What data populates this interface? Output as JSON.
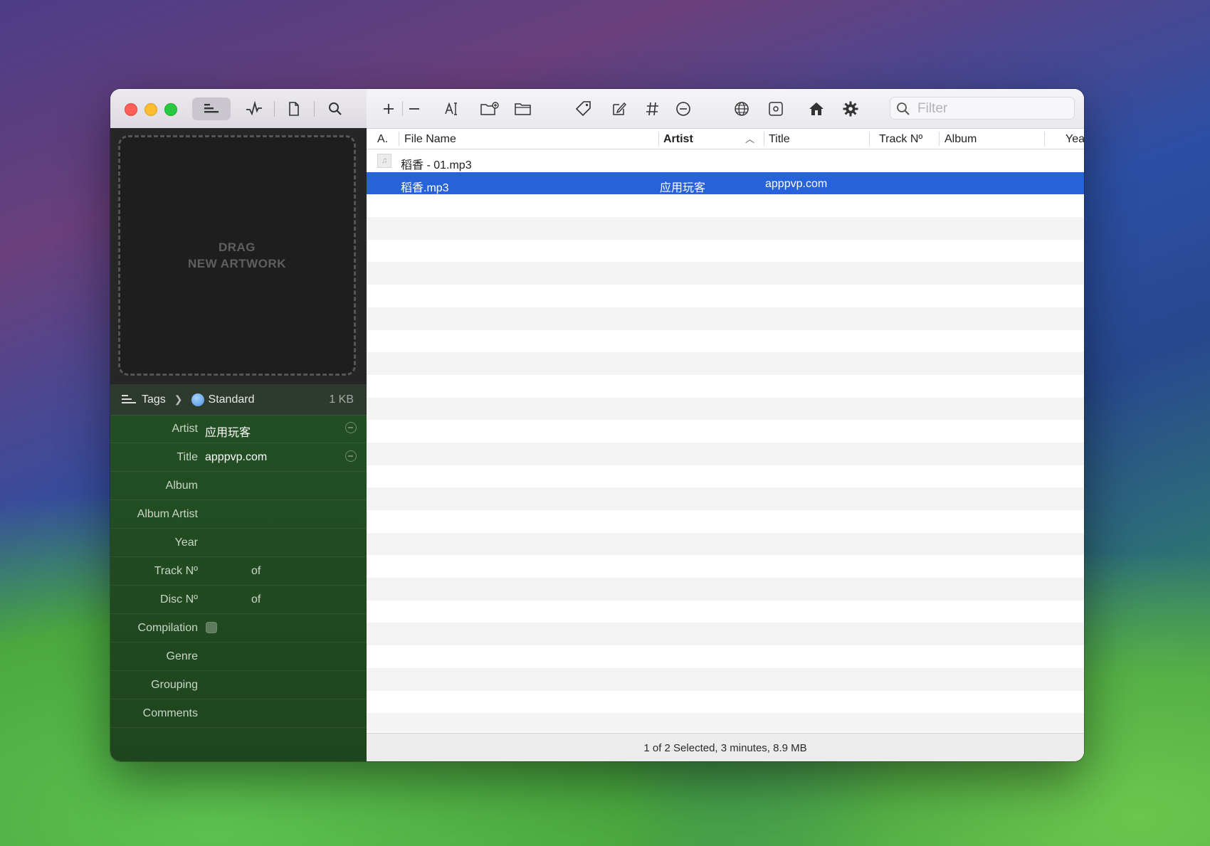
{
  "artwork": {
    "line1": "DRAG",
    "line2": "NEW ARTWORK"
  },
  "tags_bar": {
    "tags_label": "Tags",
    "format_label": "Standard",
    "size": "1 KB"
  },
  "fields": [
    {
      "label": "Artist",
      "value": "应用玩客",
      "clearable": true
    },
    {
      "label": "Title",
      "value": "apppvp.com",
      "clearable": true
    },
    {
      "label": "Album",
      "value": ""
    },
    {
      "label": "Album Artist",
      "value": ""
    },
    {
      "label": "Year",
      "value": ""
    },
    {
      "label": "Track Nº",
      "value": "",
      "of": "of"
    },
    {
      "label": "Disc Nº",
      "value": "",
      "of": "of"
    },
    {
      "label": "Compilation",
      "checkbox": true
    },
    {
      "label": "Genre",
      "value": ""
    },
    {
      "label": "Grouping",
      "value": ""
    },
    {
      "label": "Comments",
      "value": ""
    }
  ],
  "filter": {
    "placeholder": "Filter"
  },
  "columns": {
    "a": "A.",
    "file_name": "File Name",
    "artist": "Artist",
    "title": "Title",
    "track": "Track Nº",
    "album": "Album",
    "year": "Yea"
  },
  "files": [
    {
      "file_name": "稻香 - 01.mp3",
      "artist": "",
      "title": "",
      "selected": false,
      "icon": "music-note-icon"
    },
    {
      "file_name": "稻香.mp3",
      "artist": "应用玩客",
      "title": "apppvp.com",
      "selected": true
    }
  ],
  "status": "1 of 2 Selected, 3 minutes, 8.9 MB",
  "colors": {
    "selection": "#2662d9",
    "sidebar": "#245024"
  }
}
